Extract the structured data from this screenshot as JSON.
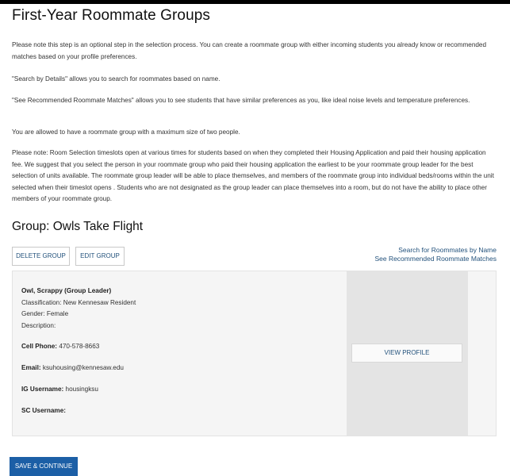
{
  "page": {
    "title": "First-Year Roommate Groups",
    "paragraphs": [
      "Please note this step is an optional step in the selection process. You can create a roommate group with either incoming students you already know or recommended matches based on your profile preferences.",
      "\"Search by Details\" allows you to search for roommates based on name.",
      "\"See Recommended Roommate Matches\" allows you to see students that have similar preferences as you, like ideal noise levels and temperature preferences.",
      "You are allowed to have a roommate group with a maximum size of two people.",
      "Please note: Room Selection timeslots open at various times for students based on when they completed their Housing Application and paid their housing application fee. We suggest that you select the person in your roommate group who paid their housing application the earliest to be your roommate group leader for the best selection of units available. The roommate group leader will be able to place themselves, and members of the roommate group into individual beds/rooms within the unit selected when their timeslot opens . Students who are not designated as the group leader can place themselves into a room, but do not have the ability to place other members of your roommate group."
    ]
  },
  "group": {
    "heading": "Group: Owls Take Flight",
    "delete_label": "DELETE GROUP",
    "edit_label": "EDIT GROUP",
    "search_link": "Search for Roommates by Name",
    "recommended_link": "See Recommended Roommate Matches"
  },
  "member": {
    "name": "Owl, Scrappy (Group Leader)",
    "classification": "Classification: New Kennesaw Resident",
    "gender": "Gender: Female",
    "description": "Description:",
    "cell_label": "Cell Phone:",
    "cell_value": "470-578-8663",
    "email_label": "Email:",
    "email_value": "ksuhousing@kennesaw.edu",
    "ig_label": "IG Username:",
    "ig_value": "housingksu",
    "sc_label": "SC Username:",
    "sc_value": "",
    "view_profile_label": "VIEW PROFILE"
  },
  "footer": {
    "save_label": "SAVE & CONTINUE"
  },
  "colors": {
    "link": "#23527c",
    "primary_button": "#1c5fa6",
    "card_bg": "#f5f5f5"
  }
}
